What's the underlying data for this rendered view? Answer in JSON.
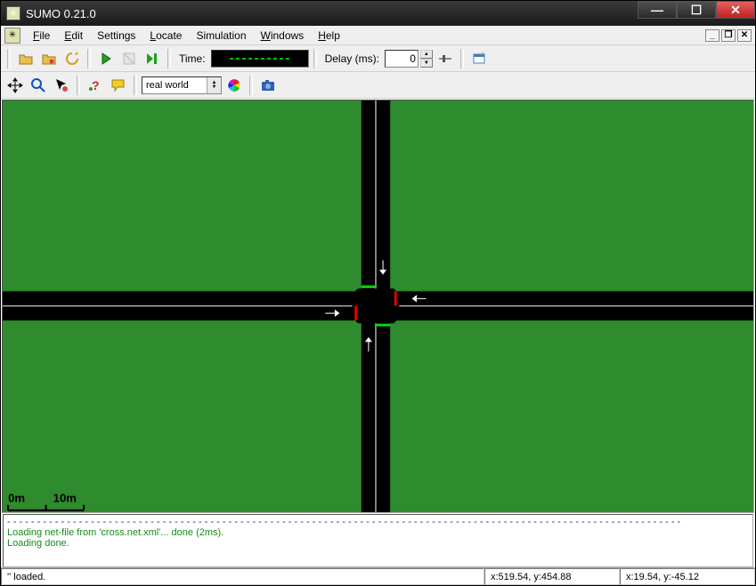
{
  "titlebar": {
    "title": "SUMO 0.21.0"
  },
  "menu": {
    "file": "File",
    "edit": "Edit",
    "settings": "Settings",
    "locate": "Locate",
    "simulation": "Simulation",
    "windows": "Windows",
    "help": "Help"
  },
  "toolbar1": {
    "time_label": "Time:",
    "delay_label": "Delay (ms):",
    "delay_value": "0"
  },
  "toolbar2": {
    "scheme_selected": "real world"
  },
  "viewport": {
    "scale_left": "0m",
    "scale_right": "10m"
  },
  "log": {
    "line1": "Loading net-file from 'cross.net.xml'...  done (2ms).",
    "line2": "Loading done."
  },
  "status": {
    "main": "'' loaded.",
    "coord1": "x:519.54, y:454.88",
    "coord2": "x:19.54, y:-45.12"
  },
  "colors": {
    "grass": "#2e8b2e",
    "road": "#000000",
    "tls_green": "#00d000",
    "tls_red": "#e00000",
    "log_blue": "#2a2a80",
    "log_green": "#1a8a1a"
  }
}
